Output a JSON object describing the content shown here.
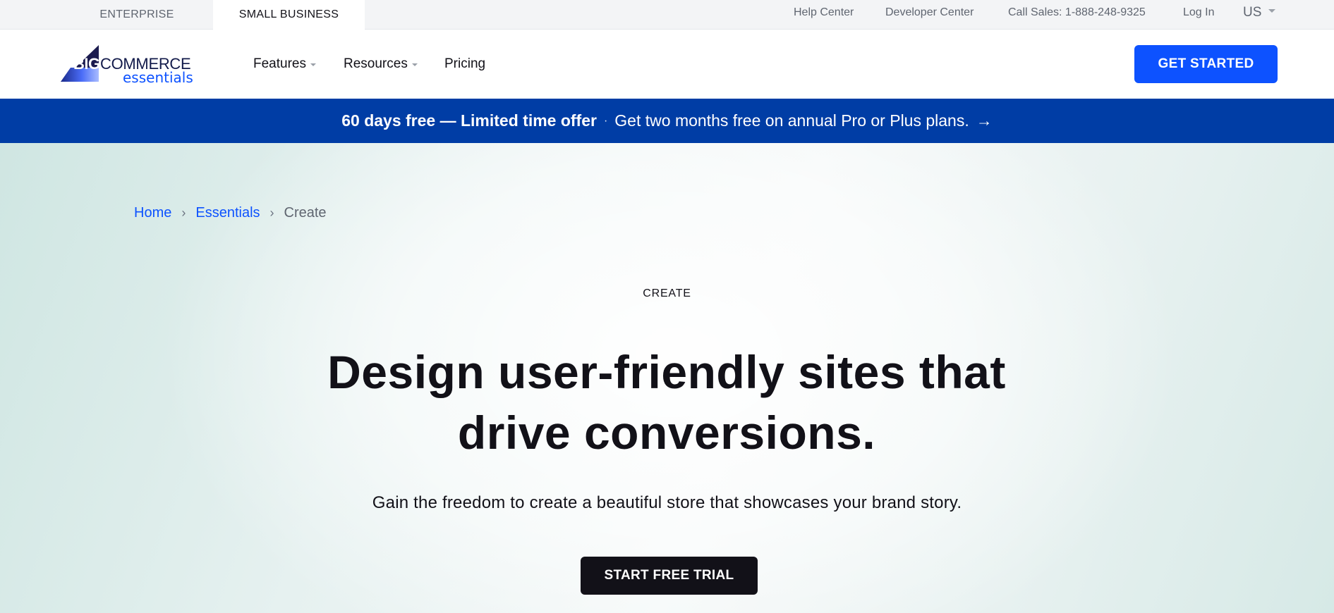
{
  "utility_bar": {
    "segments": [
      {
        "label": "ENTERPRISE",
        "active": false
      },
      {
        "label": "SMALL BUSINESS",
        "active": true
      }
    ],
    "links": {
      "help": "Help Center",
      "developer": "Developer Center",
      "sales": "Call Sales: 1-888-248-9325",
      "login": "Log In",
      "region": "US"
    }
  },
  "nav": {
    "logo": {
      "big": "BIG",
      "commerce": "COMMERCE",
      "sub": "essentials"
    },
    "items": [
      {
        "label": "Features",
        "has_dropdown": true
      },
      {
        "label": "Resources",
        "has_dropdown": true
      },
      {
        "label": "Pricing",
        "has_dropdown": false
      }
    ],
    "cta": "GET STARTED"
  },
  "promo": {
    "strong": "60 days free — Limited time offer",
    "separator": "·",
    "text": "Get two months free on annual Pro or Plus plans.",
    "arrow": "→"
  },
  "hero": {
    "breadcrumb": [
      {
        "label": "Home",
        "link": true
      },
      {
        "label": "Essentials",
        "link": true
      },
      {
        "label": "Create",
        "link": false
      }
    ],
    "breadcrumb_sep": "›",
    "eyebrow": "CREATE",
    "title_line1": "Design user-friendly sites that",
    "title_line2": "drive conversions.",
    "subtitle": "Gain the freedom to create a beautiful store that showcases your brand story.",
    "cta": "START FREE TRIAL"
  },
  "colors": {
    "brand_blue": "#0d52ff",
    "banner_blue": "#003da5",
    "dark": "#121118",
    "logo_navy": "#121a4a"
  },
  "icons": {
    "region_caret": "chevron-down-icon",
    "nav_caret": "chevron-down-icon",
    "breadcrumb_separator": "chevron-right-icon",
    "promo_arrow": "arrow-right-icon"
  }
}
